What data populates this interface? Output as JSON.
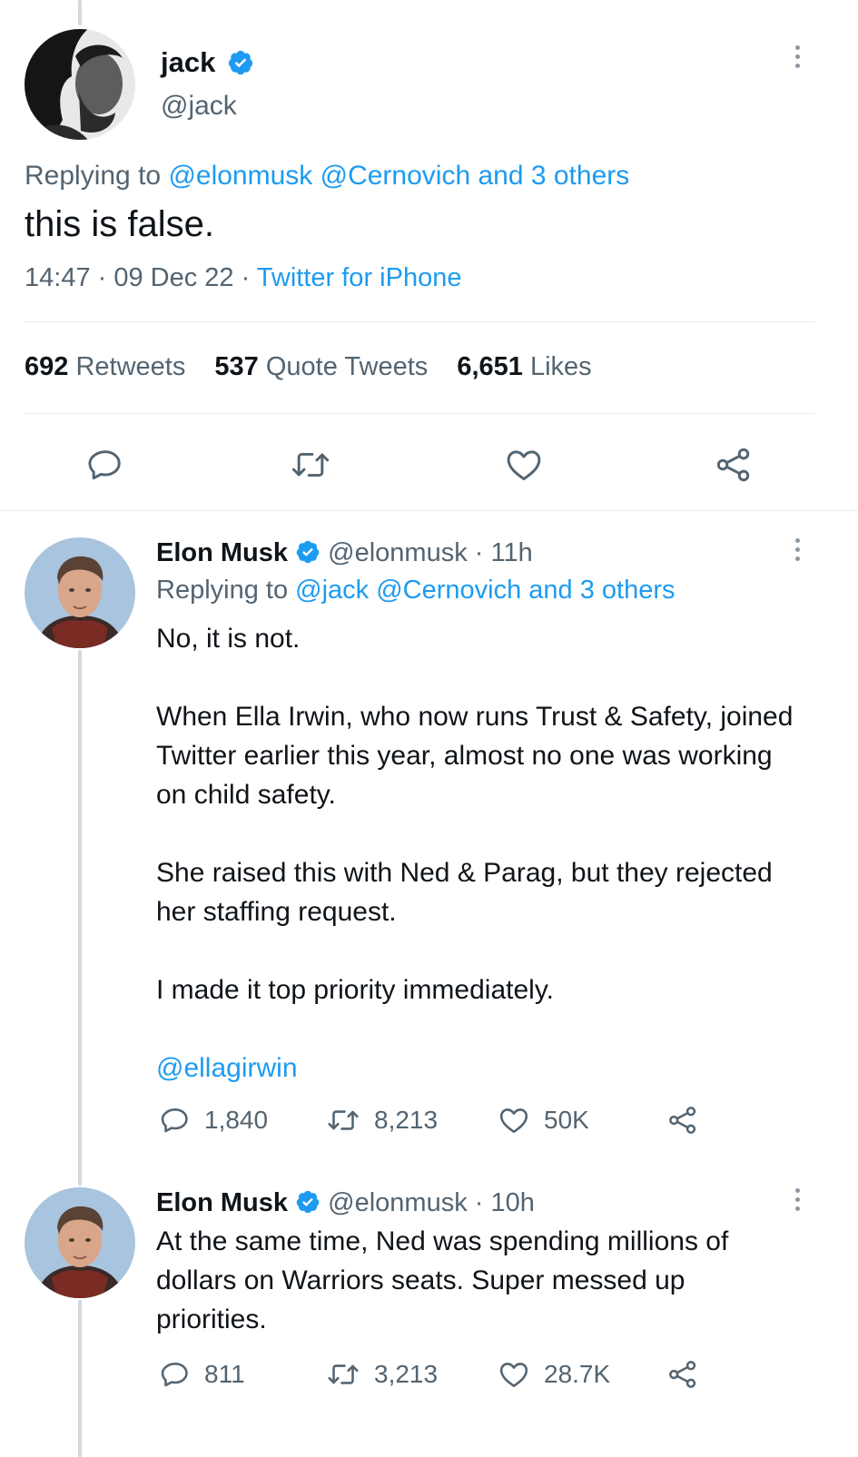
{
  "main_tweet": {
    "display_name": "jack",
    "handle": "@jack",
    "replying_label": "Replying to",
    "replying_mentions": "@elonmusk @Cernovich and 3 others",
    "text": "this is false.",
    "time_date": "14:47 · 09 Dec 22 · ",
    "source": "Twitter for iPhone",
    "stats": {
      "retweets_count": "692",
      "retweets_label": "Retweets",
      "quotes_count": "537",
      "quotes_label": "Quote Tweets",
      "likes_count": "6,651",
      "likes_label": "Likes"
    }
  },
  "replies": [
    {
      "display_name": "Elon Musk",
      "handle_time": "@elonmusk · 11h",
      "replying_label": "Replying to",
      "replying_mentions": "@jack @Cernovich and 3 others",
      "paragraphs": [
        "No, it is not.",
        "When Ella Irwin, who now runs Trust & Safety, joined Twitter earlier this year, almost no one was working on child safety.",
        "She raised this with Ned & Parag, but they rejected her staffing request.",
        "I made it top priority immediately."
      ],
      "mention": "@ellagirwin",
      "replies_count": "1,840",
      "retweets_count": "8,213",
      "likes_count": "50K"
    },
    {
      "display_name": "Elon Musk",
      "handle_time": "@elonmusk · 10h",
      "text": "At the same time, Ned was spending millions of dollars on Warriors seats. Super messed up priorities.",
      "replies_count": "811",
      "retweets_count": "3,213",
      "likes_count": "28.7K"
    }
  ],
  "colors": {
    "accent": "#1d9bf0",
    "secondary_text": "#536471",
    "divider": "#e6ecf0"
  },
  "icons": [
    "more-icon",
    "verified-badge-icon",
    "reply-icon",
    "retweet-icon",
    "like-icon",
    "share-icon"
  ]
}
